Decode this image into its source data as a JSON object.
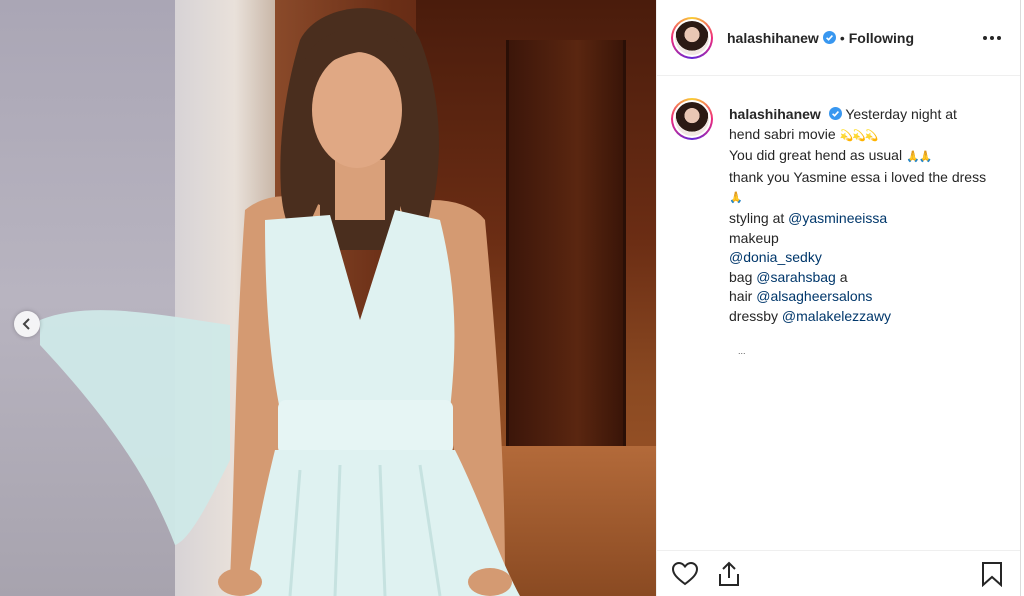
{
  "post": {
    "username": "halashihanew",
    "separator": "•",
    "follow_status": "Following"
  },
  "caption": {
    "username": "halashihanew",
    "line1": "Yesterday night at hend sabri movie",
    "line1_emoji": "💫💫💫",
    "line2": "You did great hend as usual",
    "line2_emoji": "🙏🙏",
    "line3": "thank you Yasmine essa i loved the dress",
    "line3_emoji": "🙏",
    "styling_label": "styling at",
    "styling_mention": "@yasmineeissa",
    "makeup_label": "makeup",
    "makeup_mention": "@donia_sedky",
    "bag_label": "bag",
    "bag_mention": "@sarahsbag",
    "bag_suffix": "a",
    "hair_label": "hair",
    "hair_mention": "@alsagheersalons",
    "dress_label": "dressby",
    "dress_mention": "@malakelezzawy",
    "tiny_mark": "..."
  },
  "icons": {
    "verified": "verified-badge-icon",
    "more": "more-options-icon",
    "prev": "chevron-left-icon",
    "like": "heart-icon",
    "share": "share-icon",
    "save": "bookmark-icon"
  },
  "colors": {
    "verified_blue": "#3897f0",
    "mention": "#00376b",
    "text": "#262626"
  }
}
